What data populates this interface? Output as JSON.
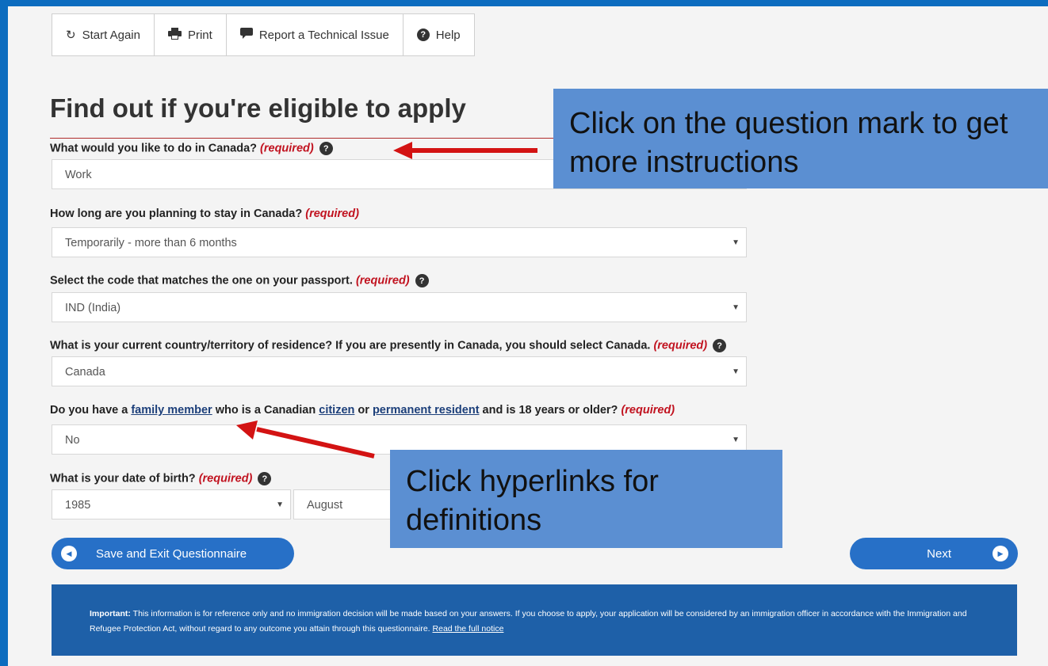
{
  "toolbar": {
    "start_again": "Start Again",
    "print": "Print",
    "report": "Report a Technical Issue",
    "help": "Help"
  },
  "heading": "Find out if you're eligible to apply",
  "questions": {
    "q1": {
      "label": "What would you like to do in Canada?",
      "required": "(required)",
      "value": "Work"
    },
    "q2": {
      "label": "How long are you planning to stay in Canada?",
      "required": "(required)",
      "value": "Temporarily - more than 6 months"
    },
    "q3": {
      "label": "Select the code that matches the one on your passport.",
      "required": "(required)",
      "value": "IND (India)"
    },
    "q4": {
      "label": "What is your current country/territory of residence? If you are presently in Canada, you should select Canada.",
      "required": "(required)",
      "value": "Canada"
    },
    "q5": {
      "text_a": "Do you have a ",
      "link_family": "family member",
      "text_b": " who is a Canadian ",
      "link_citizen": "citizen",
      "text_c": " or ",
      "link_pr": "permanent resident",
      "text_d": " and is 18 years or older?",
      "required": "(required)",
      "value": "No"
    },
    "q6": {
      "label": "What is your date of birth?",
      "required": "(required)",
      "year": "1985",
      "month": "August"
    }
  },
  "buttons": {
    "save_exit": "Save and Exit Questionnaire",
    "next": "Next"
  },
  "notice": {
    "important": "Important:",
    "text": " This information is for reference only and no immigration decision will be made based on your answers. If you choose to apply, your application will be considered by an immigration officer in accordance with the Immigration and Refugee Protection Act, without regard to any outcome you attain through this questionnaire. ",
    "link": "Read the full notice"
  },
  "callouts": {
    "question_mark": "Click on the question mark to get more instructions",
    "hyperlinks": "Click hyperlinks for definitions"
  },
  "colors": {
    "frame": "#0c6cbf",
    "accent_blue": "#2770c7",
    "notice_bg": "#1e60a8",
    "required_red": "#c1121f",
    "callout_bg": "#5b8fd2",
    "arrow_red": "#d31313"
  }
}
